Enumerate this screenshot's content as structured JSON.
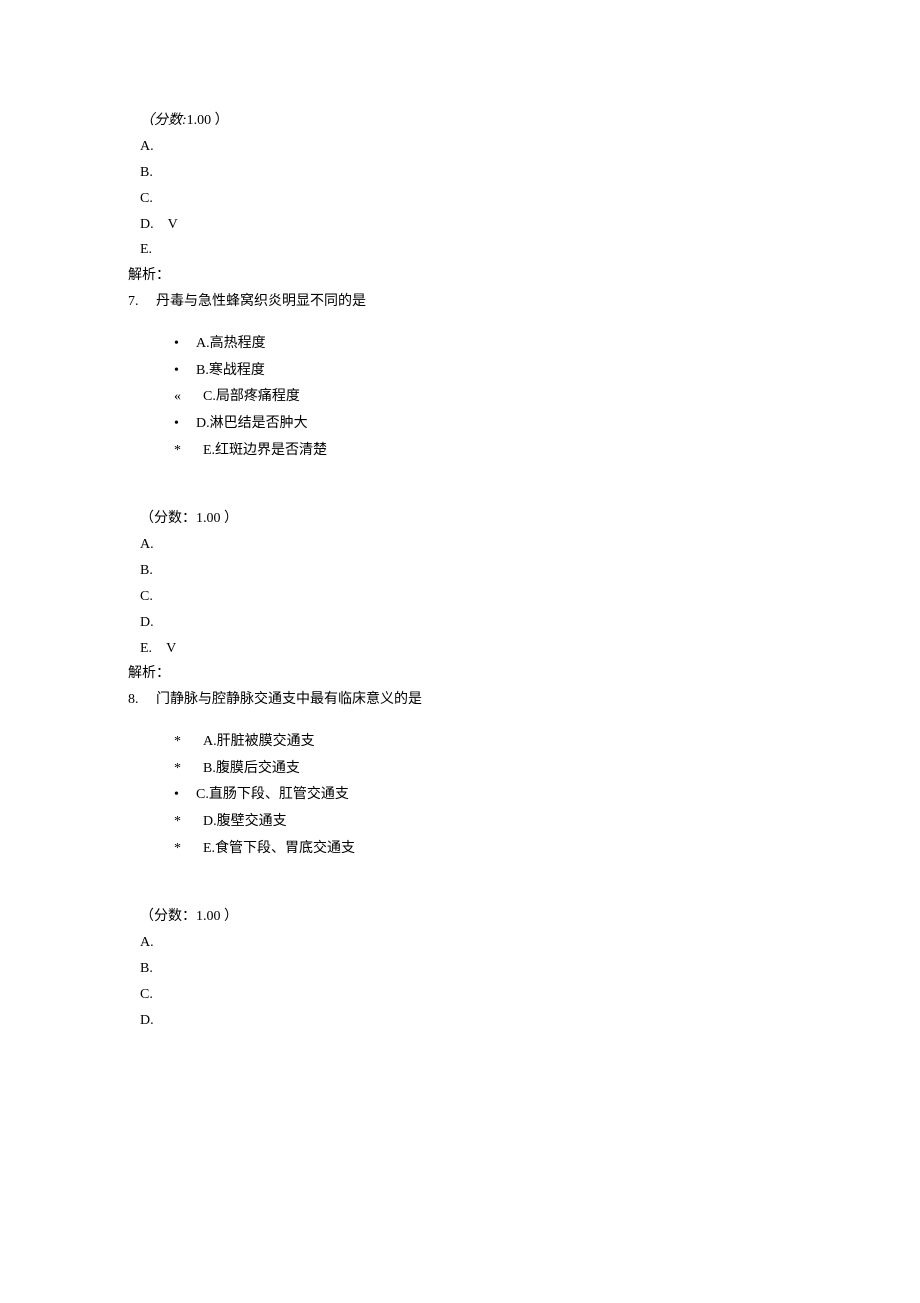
{
  "q6": {
    "score_label": "（分数:",
    "score_value": "1.00 ）",
    "answers": {
      "a": "A.",
      "b": "B.",
      "c": "C.",
      "d": "D.",
      "e": "E.",
      "check_d": "V"
    },
    "jiexi": "解析："
  },
  "q7": {
    "number": "7.",
    "stem": "丹毒与急性蜂窝织炎明显不同的是",
    "options": {
      "a_bullet": "•",
      "a_text": "A.高热程度",
      "b_bullet": "•",
      "b_text": "B.寒战程度",
      "c_bullet": "«",
      "c_text": "C.局部疼痛程度",
      "d_bullet": "•",
      "d_text": "D.淋巴结是否肿大",
      "e_bullet": "*",
      "e_text": "E.红斑边界是否清楚"
    },
    "score_label": "（分数：",
    "score_value": "1.00 ）",
    "answers": {
      "a": "A.",
      "b": "B.",
      "c": "C.",
      "d": "D.",
      "e": "E.",
      "check_e": "V"
    },
    "jiexi": "解析："
  },
  "q8": {
    "number": "8.",
    "stem": "门静脉与腔静脉交通支中最有临床意义的是",
    "options": {
      "a_bullet": "*",
      "a_text": "A.肝脏被膜交通支",
      "b_bullet": "*",
      "b_text": "B.腹膜后交通支",
      "c_bullet": "•",
      "c_text": "C.直肠下段、肛管交通支",
      "d_bullet": "*",
      "d_text": "D.腹壁交通支",
      "e_bullet": "*",
      "e_text": "E.食管下段、胃底交通支"
    },
    "score_label": "（分数：",
    "score_value": "1.00 ）",
    "answers": {
      "a": "A.",
      "b": "B.",
      "c": "C.",
      "d": "D."
    }
  }
}
